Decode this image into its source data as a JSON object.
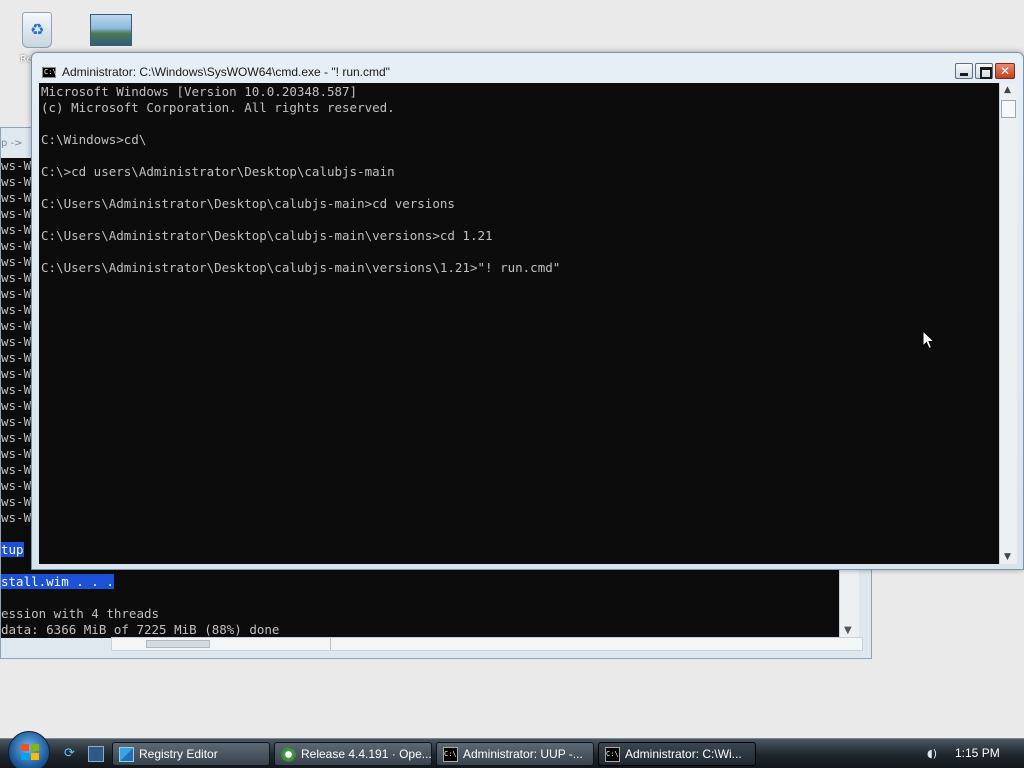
{
  "desktop": {
    "recycle_bin_label": "Recy"
  },
  "background_window": {
    "breadcrumb": "p -> ",
    "lines": [
      "ws-W",
      "ws-W",
      "ws-W",
      "ws-W",
      "ws-W",
      "ws-W",
      "ws-W",
      "ws-W",
      "ws-W",
      "ws-W",
      "ws-W",
      "ws-W",
      "ws-W",
      "ws-W",
      "ws-W",
      "ws-W",
      "ws-W",
      "ws-W",
      "ws-W",
      "ws-W",
      "ws-W",
      "ws-W",
      "ws-W"
    ],
    "highlight_1": "tup",
    "highlight_2": "stall.wim . . .",
    "line_threads": "ession with 4 threads",
    "line_progress": "data: 6366 MiB of 7225 MiB (88%) done"
  },
  "cmd_window": {
    "icon_text": "C:\\",
    "title": "Administrator: C:\\Windows\\SysWOW64\\cmd.exe - \"! run.cmd\"",
    "console_lines": [
      "Microsoft Windows [Version 10.0.20348.587]",
      "(c) Microsoft Corporation. All rights reserved.",
      "",
      "C:\\Windows>cd\\",
      "",
      "C:\\>cd users\\Administrator\\Desktop\\calubjs-main",
      "",
      "C:\\Users\\Administrator\\Desktop\\calubjs-main>cd versions",
      "",
      "C:\\Users\\Administrator\\Desktop\\calubjs-main\\versions>cd 1.21",
      "",
      "C:\\Users\\Administrator\\Desktop\\calubjs-main\\versions\\1.21>\"! run.cmd\""
    ]
  },
  "taskbar": {
    "tasks": [
      {
        "label": "Registry Editor",
        "icon": "registry-icon"
      },
      {
        "label": "Release 4.4.191 · Ope...",
        "icon": "browser-icon"
      },
      {
        "label": "Administrator:  UUP -...",
        "icon": "cmd-icon"
      },
      {
        "label": "Administrator: C:\\Wi...",
        "icon": "cmd-icon"
      }
    ],
    "cmd_icon_text": "C:\\",
    "clock": "1:15 PM"
  },
  "colors": {
    "console_bg": "#0c0c0c",
    "console_fg": "#c0c0c0",
    "selection": "#1c50d6",
    "taskbar": "#1f262d"
  }
}
